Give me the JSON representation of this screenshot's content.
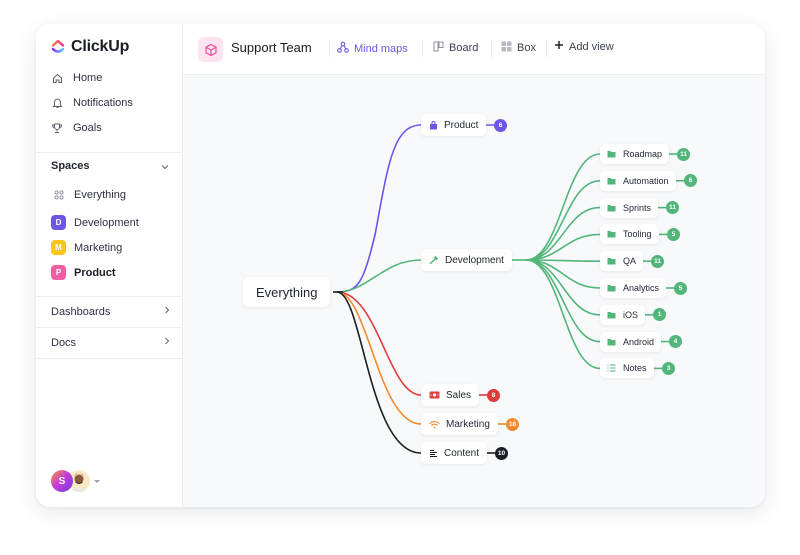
{
  "brand": {
    "name": "ClickUp"
  },
  "sidebar": {
    "nav": [
      {
        "label": "Home",
        "icon": "home-icon"
      },
      {
        "label": "Notifications",
        "icon": "bell-icon"
      },
      {
        "label": "Goals",
        "icon": "trophy-icon"
      }
    ],
    "spaces_title": "Spaces",
    "everything_label": "Everything",
    "spaces": [
      {
        "letter": "D",
        "label": "Development",
        "color": "#6b57e6"
      },
      {
        "letter": "M",
        "label": "Marketing",
        "color": "#fbc418"
      },
      {
        "letter": "P",
        "label": "Product",
        "color": "#f25ea4"
      }
    ],
    "dashboards_label": "Dashboards",
    "docs_label": "Docs",
    "user_initial": "S"
  },
  "topbar": {
    "team_name": "Support Team",
    "views": [
      {
        "label": "Mind maps",
        "icon": "mindmap-icon",
        "active": true
      },
      {
        "label": "Board",
        "icon": "board-icon",
        "active": false
      },
      {
        "label": "Box",
        "icon": "box-icon",
        "active": false
      }
    ],
    "add_view_label": "Add view"
  },
  "mindmap": {
    "root": "Everything",
    "branches": [
      {
        "label": "Product",
        "count": "6",
        "color": "#6b57e6",
        "icon": "bag-icon"
      },
      {
        "label": "Development",
        "color": "#52b67a",
        "icon": "hammer-icon"
      },
      {
        "label": "Sales",
        "count": "8",
        "color": "#e13b3b",
        "icon": "money-icon"
      },
      {
        "label": "Marketing",
        "count": "18",
        "color": "#f38a2b",
        "icon": "wifi-icon"
      },
      {
        "label": "Content",
        "count": "10",
        "color": "#1b1d25",
        "icon": "text-lines-icon"
      }
    ],
    "development_children": [
      {
        "label": "Roadmap",
        "count": "11",
        "icon": "folder-icon"
      },
      {
        "label": "Automation",
        "count": "6",
        "icon": "folder-icon"
      },
      {
        "label": "Sprints",
        "count": "11",
        "icon": "folder-icon"
      },
      {
        "label": "Tooling",
        "count": "5",
        "icon": "folder-icon"
      },
      {
        "label": "QA",
        "count": "11",
        "icon": "folder-icon"
      },
      {
        "label": "Analytics",
        "count": "5",
        "icon": "folder-icon"
      },
      {
        "label": "iOS",
        "count": "1",
        "icon": "folder-icon"
      },
      {
        "label": "Android",
        "count": "4",
        "icon": "folder-icon"
      },
      {
        "label": "Notes",
        "count": "3",
        "icon": "list-icon"
      }
    ]
  }
}
